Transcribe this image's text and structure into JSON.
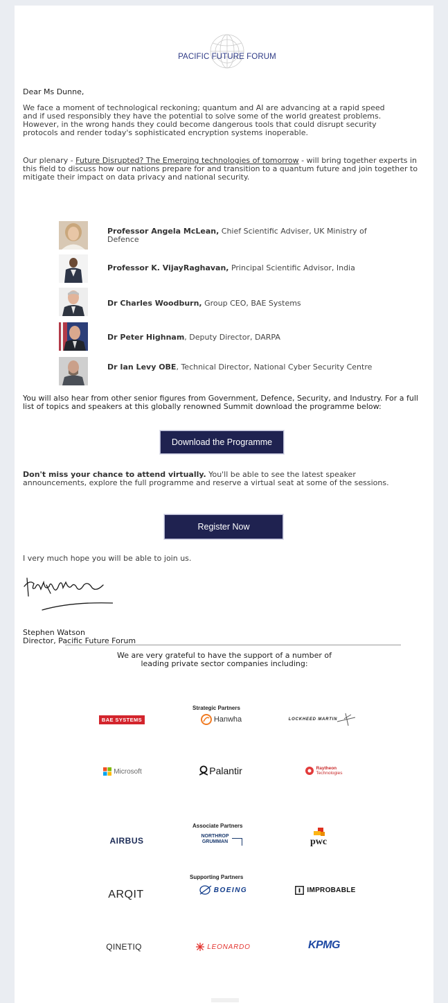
{
  "brand": {
    "name": "PACIFIC FUTURE FORUM"
  },
  "letter": {
    "greeting": "Dear Ms Dunne,",
    "p1": "We face a moment of technological reckoning; quantum and AI are advancing at a rapid speed and if used responsibly they have the potential to solve some of the world greatest problems. However, in the wrong hands they could become dangerous tools that could disrupt security protocols and render today's sophisticated encryption systems inoperable.",
    "p2_before": "Our plenary - ",
    "p2_link": "Future Disrupted? The Emerging technologies of tomorrow",
    "p2_after": " - will bring together experts in this field to discuss how our nations prepare for and transition to a quantum future and join together to mitigate their impact on data privacy and national security.",
    "p3": "You will also hear from other senior figures from Government, Defence, Security, and Industry. For a full list of topics and speakers at this globally renowned Summit download the programme below:",
    "p4_bold": "Don't miss your chance to attend virtually.",
    "p4_rest": " You'll be able to see the latest speaker announcements, explore the full programme and reserve a virtual seat at some of the sessions.",
    "p5": "I very much hope you will be able to join us.",
    "signer_name": "Stephen Watson",
    "signer_title": "Director, Pacific Future Forum"
  },
  "speakers": [
    {
      "name": "Professor Angela McLean,",
      "role": " Chief Scientific Adviser, UK Ministry of Defence"
    },
    {
      "name": "Professor K. VijayRaghavan,",
      "role": " Principal Scientific Advisor, India"
    },
    {
      "name": "Dr Charles Woodburn,",
      "role": " Group CEO, BAE Systems"
    },
    {
      "name": "Dr Peter Highnam",
      "role": ", Deputy Director, DARPA"
    },
    {
      "name": "Dr Ian Levy OBE",
      "role": ", Technical Director, National Cyber Security Centre"
    }
  ],
  "buttons": {
    "download": "Download the Programme",
    "register": "Register Now"
  },
  "sponsors": {
    "intro": "We are very grateful to have the support of a number of leading private sector companies including:",
    "group_strategic": "Strategic Partners",
    "group_associate": "Associate Partners",
    "group_supporting": "Supporting Partners",
    "bae": "BAE SYSTEMS",
    "hanwha": "Hanwha",
    "lockheed": "LOCKHEED MARTIN",
    "microsoft": "Microsoft",
    "palantir": "Palantir",
    "raytheon_1": "Raytheon",
    "raytheon_2": "Technologies",
    "airbus": "AIRBUS",
    "northrop_1": "NORTHROP",
    "northrop_2": "GRUMMAN",
    "pwc": "pwc",
    "arqit": "ARQIT",
    "boeing": "BOEING",
    "improbable": "IMPROBABLE",
    "qinetiq": "QINETIQ",
    "leonardo": "LEONARDO",
    "kpmg": "KPMG"
  },
  "colors": {
    "button_bg": "#1f2250",
    "brand_blue": "#2e3a86",
    "bae_red": "#d3242c"
  }
}
